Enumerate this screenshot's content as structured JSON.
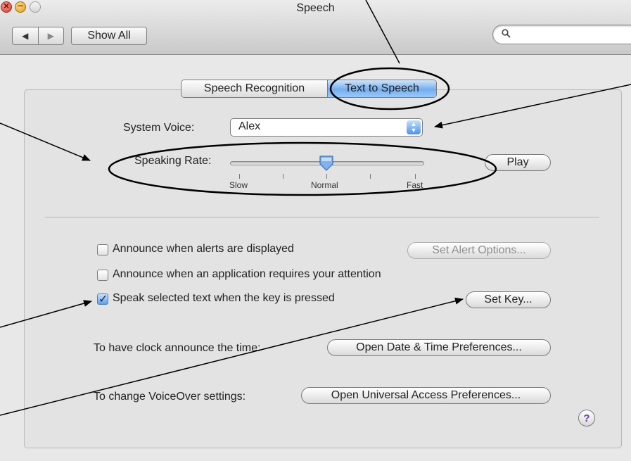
{
  "window": {
    "title": "Speech",
    "nav_back": "◀",
    "nav_forward": "▶",
    "show_all": "Show All",
    "search_placeholder": ""
  },
  "tabs": [
    {
      "label": "Speech Recognition",
      "selected": false
    },
    {
      "label": "Text to Speech",
      "selected": true
    }
  ],
  "voice": {
    "label": "System Voice:",
    "value": "Alex",
    "popup_arrows": "▲▼"
  },
  "rate": {
    "label": "Speaking Rate:",
    "slow": "Slow",
    "normal": "Normal",
    "fast": "Fast",
    "value_fraction": 0.5,
    "play_label": "Play"
  },
  "options": {
    "alerts": {
      "label": "Announce when alerts are displayed",
      "checked": false
    },
    "alert_options_button": "Set Alert Options...",
    "attention": {
      "label": "Announce when an application requires your attention",
      "checked": false
    },
    "speak_selected": {
      "label": "Speak selected text when the key is pressed",
      "checked": true
    },
    "set_key_button": "Set Key...",
    "check_mark": "✓"
  },
  "clock": {
    "label": "To have clock announce the time:",
    "button": "Open Date & Time Preferences..."
  },
  "voiceover": {
    "label": "To change VoiceOver settings:",
    "button": "Open Universal Access Preferences..."
  },
  "help": "?",
  "colors": {
    "tab_selected": "#72aef0",
    "checkbox_checked": "#5d9fec",
    "annotation": "#000000"
  }
}
